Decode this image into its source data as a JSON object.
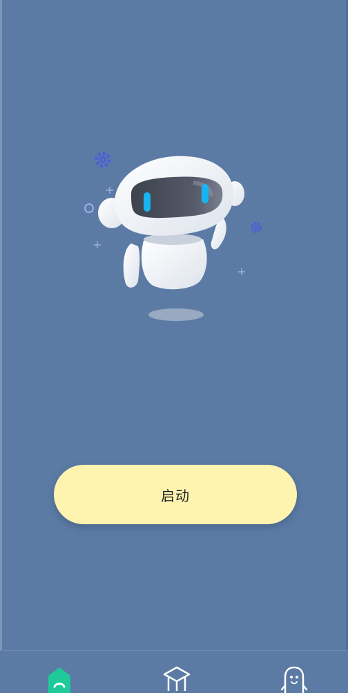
{
  "main": {
    "start_button_label": "启动"
  },
  "robot": {
    "icon": "robot-mascot-icon",
    "decorations": [
      "gear-icon",
      "gear-icon",
      "circle-icon",
      "plus-icon",
      "plus-icon",
      "plus-icon",
      "plus-icon"
    ]
  },
  "tabbar": {
    "tabs": [
      {
        "icon": "home-icon",
        "active": true
      },
      {
        "icon": "graduation-cap-icon",
        "active": false
      },
      {
        "icon": "user-profile-icon",
        "active": false
      }
    ]
  },
  "colors": {
    "background": "#5b7ba5",
    "button": "#fff3b0",
    "tab_active": "#1ec99a",
    "tab_inactive": "#ffffff",
    "robot_visor": "#4a4f5c",
    "robot_eyes": "#18b4f0",
    "decor_accent": "#4b5fd6"
  }
}
